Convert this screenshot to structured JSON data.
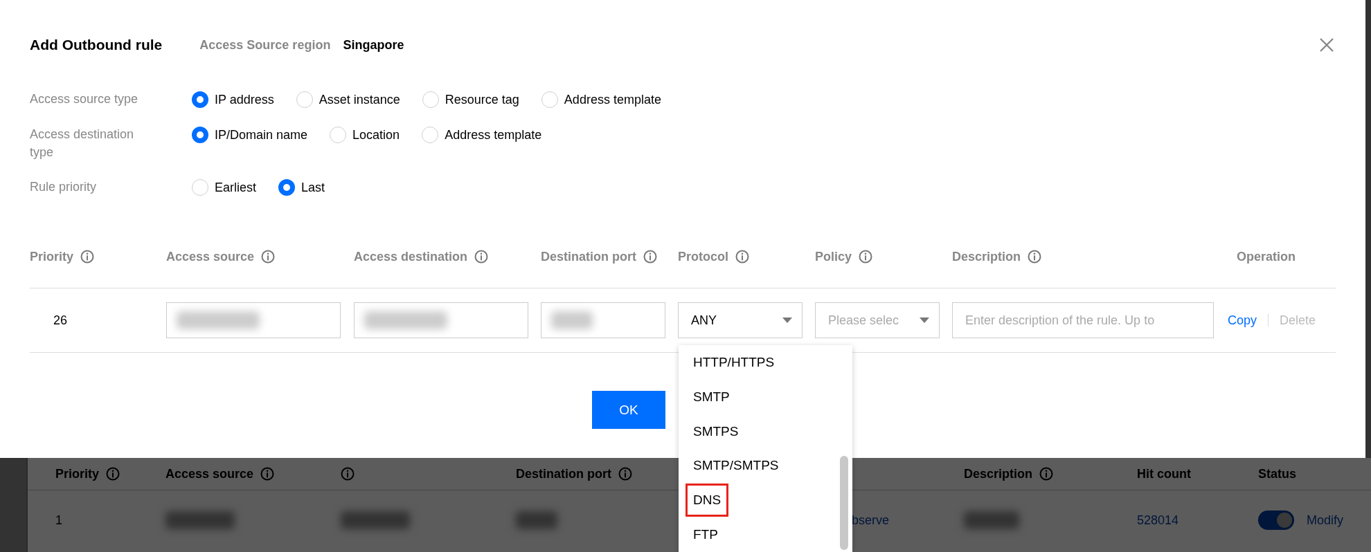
{
  "dialog": {
    "title": "Add Outbound rule",
    "region_label": "Access Source region",
    "region_value": "Singapore"
  },
  "form_rows": [
    {
      "label": "Access source type",
      "options": [
        {
          "label": "IP address",
          "selected": true
        },
        {
          "label": "Asset instance",
          "selected": false
        },
        {
          "label": "Resource tag",
          "selected": false
        },
        {
          "label": "Address template",
          "selected": false
        }
      ]
    },
    {
      "label": "Access destination type",
      "options": [
        {
          "label": "IP/Domain name",
          "selected": true
        },
        {
          "label": "Location",
          "selected": false
        },
        {
          "label": "Address template",
          "selected": false
        }
      ]
    },
    {
      "label": "Rule priority",
      "options": [
        {
          "label": "Earliest",
          "selected": false
        },
        {
          "label": "Last",
          "selected": true
        }
      ]
    }
  ],
  "table": {
    "columns": [
      {
        "label": "Priority",
        "info": true
      },
      {
        "label": "Access source",
        "info": true
      },
      {
        "label": "Access destination",
        "info": true
      },
      {
        "label": "Destination port",
        "info": true
      },
      {
        "label": "Protocol",
        "info": true
      },
      {
        "label": "Policy",
        "info": true
      },
      {
        "label": "Description",
        "info": true
      },
      {
        "label": "Operation",
        "info": false
      }
    ],
    "row": {
      "priority": "26",
      "protocol": "ANY",
      "policy_placeholder": "Please selec",
      "description_placeholder": "Enter description of the rule. Up to",
      "actions": [
        {
          "label": "Copy",
          "disabled": false
        },
        {
          "label": "Delete",
          "disabled": true
        }
      ]
    }
  },
  "ok_button": "OK",
  "dropdown": {
    "options": [
      {
        "label": "HTTP/HTTPS",
        "highlighted": false
      },
      {
        "label": "SMTP",
        "highlighted": false
      },
      {
        "label": "SMTPS",
        "highlighted": false
      },
      {
        "label": "SMTP/SMTPS",
        "highlighted": false
      },
      {
        "label": "DNS",
        "highlighted": true
      },
      {
        "label": "FTP",
        "highlighted": false
      }
    ]
  },
  "background_table": {
    "columns": [
      {
        "label": "Priority",
        "info": true
      },
      {
        "label": "Access source",
        "info": true
      },
      {
        "info": true
      },
      {
        "label": "Destination port",
        "info": true
      },
      {
        "label": "Description",
        "info": true
      },
      {
        "label": "Hit count",
        "info": false
      },
      {
        "label": "Status",
        "info": false
      }
    ],
    "row": {
      "priority": "1",
      "policy": "bserve",
      "hit_count": "528014",
      "status_on": true,
      "action": "Modify"
    }
  }
}
